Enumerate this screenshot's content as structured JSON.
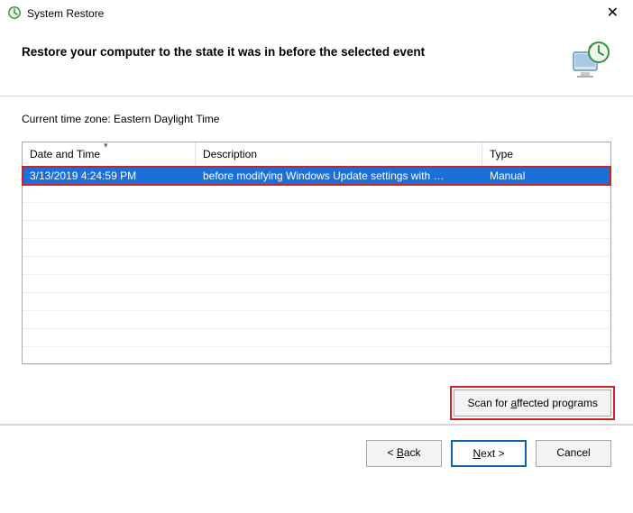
{
  "window": {
    "title": "System Restore",
    "close_label": "✕"
  },
  "heading": "Restore your computer to the state it was in before the selected event",
  "timezone_label": "Current time zone: Eastern Daylight Time",
  "columns": {
    "date": "Date and Time",
    "desc": "Description",
    "type": "Type"
  },
  "rows": [
    {
      "date": "3/13/2019 4:24:59 PM",
      "desc": "before modifying Windows Update settings with …",
      "type": "Manual",
      "selected": true
    }
  ],
  "empty_row_count": 10,
  "buttons": {
    "scan_prefix": "Scan for ",
    "scan_ul": "a",
    "scan_suffix": "ffected programs",
    "back_prefix": "< ",
    "back_ul": "B",
    "back_suffix": "ack",
    "next_ul": "N",
    "next_suffix": "ext >",
    "cancel": "Cancel"
  }
}
